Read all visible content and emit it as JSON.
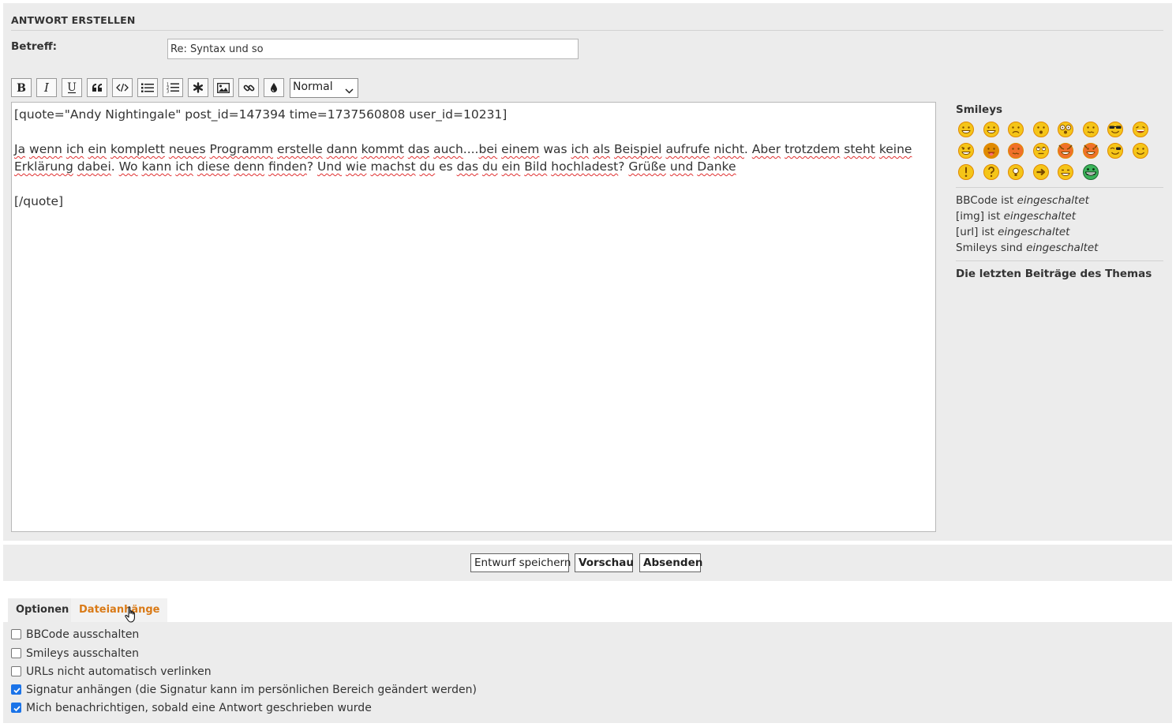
{
  "panel": {
    "title": "ANTWORT ERSTELLEN",
    "subject_label": "Betreff:",
    "subject_value": "Re: Syntax und so"
  },
  "toolbar": {
    "buttons": [
      "bold-icon",
      "italic-icon",
      "underline-icon",
      "quote-icon",
      "code-icon",
      "list-icon",
      "numbered-list-icon",
      "list-item-icon",
      "image-icon",
      "link-icon",
      "color-icon"
    ],
    "font_size_value": "Normal"
  },
  "editor": {
    "line1": "[quote=\"Andy Nightingale\" post_id=147394 time=1737560808 user_id=10231]",
    "line3": "Ja wenn ich ein komplett neues Programm erstelle dann kommt das auch....bei einem was ich als Beispiel aufrufe nicht. Aber trotzdem steht keine",
    "line4": "Erklärung dabei. Wo kann ich diese denn finden? Und wie machst du es das du ein Bild hochladest? Grüße und Danke",
    "line6": "[/quote]"
  },
  "sidebar": {
    "smileys_title": "Smileys",
    "smileys": [
      "biggrin",
      "grin",
      "sad",
      "surprised",
      "eek",
      "confused",
      "cool",
      "lol",
      "mad",
      "razz",
      "redface",
      "rolleyes",
      "twisted-evil",
      "evil",
      "wink",
      "smile",
      "exclaim",
      "question",
      "idea",
      "arrow",
      "neutral",
      "mrgreen"
    ],
    "bbcode_prefix": "BBCode ist",
    "bbcode_state": "eingeschaltet",
    "img_prefix": "[img] ist",
    "img_state": "eingeschaltet",
    "url_prefix": "[url] ist",
    "url_state": "eingeschaltet",
    "smileys_prefix": "Smileys sind",
    "smileys_state": "eingeschaltet",
    "latest_posts": "Die letzten Beiträge des Themas"
  },
  "actions": {
    "save_draft": "Entwurf speichern",
    "preview": "Vorschau",
    "submit": "Absenden"
  },
  "tabs": {
    "options": "Optionen",
    "attachments": "Dateianhänge"
  },
  "options": {
    "disable_bbcode": "BBCode ausschalten",
    "disable_smileys": "Smileys ausschalten",
    "no_auto_links": "URLs nicht automatisch verlinken",
    "attach_signature": "Signatur anhängen (die Signatur kann im persönlichen Bereich geändert werden)",
    "notify": "Mich benachrichtigen, sobald eine Antwort geschrieben wurde"
  },
  "colors": {
    "panel_bg": "#ececec",
    "accent_orange": "#d97a17",
    "checkbox_blue": "#1a73e8",
    "spellcheck_red": "#e03030"
  }
}
